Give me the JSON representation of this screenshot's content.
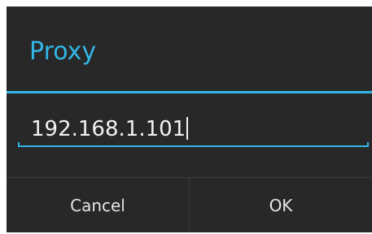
{
  "dialog": {
    "title": "Proxy",
    "input": {
      "value": "192.168.1.101"
    },
    "buttons": {
      "cancel_label": "Cancel",
      "ok_label": "OK"
    }
  },
  "colors": {
    "accent": "#33b5e5",
    "background": "#282828",
    "text": "#f2f2f2",
    "divider": "#3d3d3d"
  }
}
